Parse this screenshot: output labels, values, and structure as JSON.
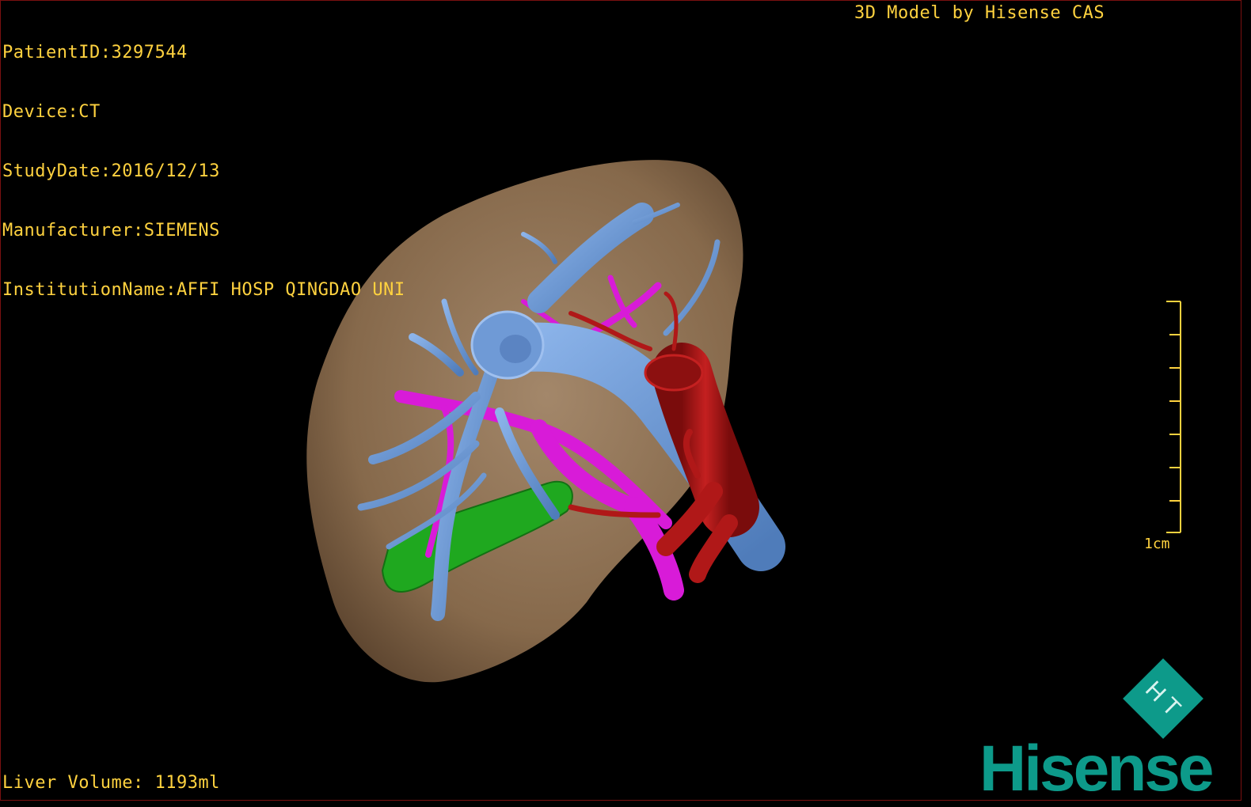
{
  "overlay_info": [
    {
      "label": "PatientID",
      "value": "3297544"
    },
    {
      "label": "Device",
      "value": "CT"
    },
    {
      "label": "StudyDate",
      "value": "2016/12/13"
    },
    {
      "label": "Manufacturer",
      "value": "SIEMENS"
    },
    {
      "label": "InstitutionName",
      "value": "AFFI HOSP QINGDAO UNI"
    }
  ],
  "title": "3D Model by Hisense CAS",
  "volume": {
    "label": "Liver Volume",
    "value": "1193ml"
  },
  "scale_bar": {
    "label": "1cm",
    "tick_count": 8
  },
  "brand": {
    "name": "Hisense",
    "logo_glyph": "H T",
    "color": "#0d9a8a"
  },
  "colors": {
    "overlay_text": "#ffd23f",
    "liver": "#8b6f4e",
    "portal_vein": "#6f9ad6",
    "hepatic_artery": "#b01818",
    "pink_vessels": "#d81bd8",
    "gallbladder": "#1fa81f"
  }
}
